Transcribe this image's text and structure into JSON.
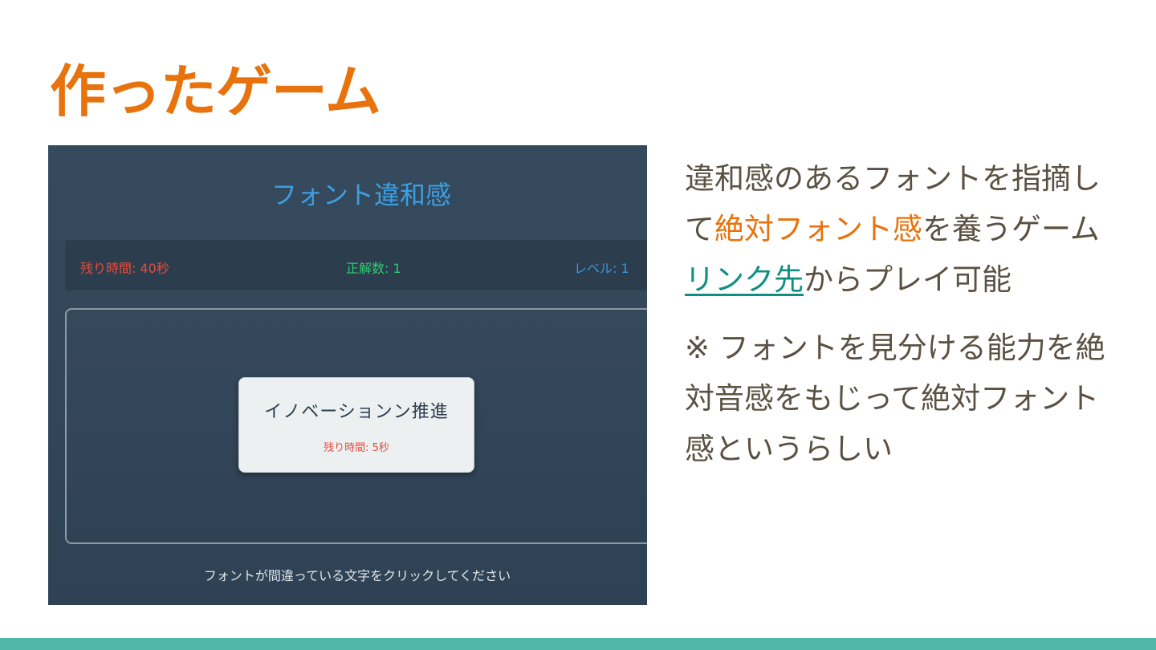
{
  "slide": {
    "title": "作ったゲーム",
    "description": {
      "line1": "違和感のあるフォントを指摘し",
      "line2_prefix": "て",
      "line2_accent": "絶対フォント感",
      "line2_suffix": "を養うゲーム",
      "line3_link": "リンク先",
      "line3_suffix": "からプレイ可能",
      "note_line1": "※ フォントを見分ける能力を絶",
      "note_line2": "対音感をもじって絶対フォント",
      "note_line3": "感というらしい"
    }
  },
  "game": {
    "title": "フォント違和感",
    "status": {
      "time_left": "残り時間: 40秒",
      "correct": "正解数: 1",
      "level": "レベル: 1"
    },
    "card": {
      "word": "イノベーションン推進",
      "timer": "残り時間: 5秒"
    },
    "instruction": "フォントが間違っている文字をクリックしてください"
  },
  "colors": {
    "accent": "#e8730d",
    "link": "#0e8f7f",
    "game_bg": "#34495e",
    "footer_bar": "#4fb8a7"
  }
}
